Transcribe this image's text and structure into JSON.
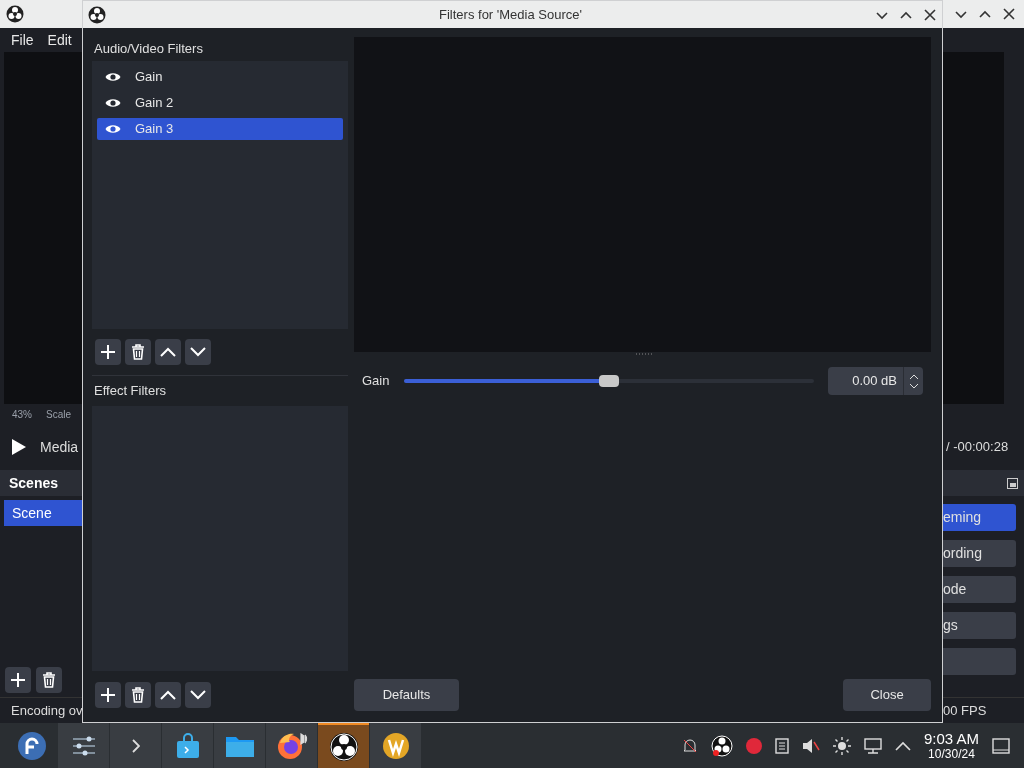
{
  "main_window": {
    "menu": [
      "File",
      "Edit"
    ],
    "zoom": "43%",
    "scale": "Scale",
    "media": "Media",
    "time": "/ -00:00:28",
    "scenes_title": "Scenes",
    "scenes": [
      {
        "label": "Scene",
        "selected": true
      }
    ],
    "controls": [
      {
        "label": "eming",
        "selected": true
      },
      {
        "label": "ording",
        "selected": false
      },
      {
        "label": "ode",
        "selected": false
      },
      {
        "label": "gs",
        "selected": false
      }
    ],
    "status_left": "Encoding ov",
    "status_right": "00 FPS"
  },
  "dialog": {
    "title": "Filters for 'Media Source'",
    "av_title": "Audio/Video Filters",
    "filters": [
      {
        "label": "Gain",
        "visible": true,
        "selected": false
      },
      {
        "label": "Gain 2",
        "visible": true,
        "selected": false
      },
      {
        "label": "Gain 3",
        "visible": true,
        "selected": true
      }
    ],
    "effect_title": "Effect Filters",
    "gain_label": "Gain",
    "gain": {
      "level": 0.5
    },
    "gain_value": "0.00 dB",
    "buttons": [
      "Defaults",
      "Close"
    ]
  },
  "taskbar": {
    "apps": [
      {
        "kind": "fedora",
        "active": false
      },
      {
        "kind": "mixer",
        "active": false
      },
      {
        "kind": "terminal",
        "active": false
      },
      {
        "kind": "store",
        "active": false
      },
      {
        "kind": "folder",
        "active": false
      },
      {
        "kind": "firefox",
        "active": false
      },
      {
        "kind": "obs",
        "active": true
      },
      {
        "kind": "wapp",
        "active": false
      }
    ],
    "time": "9:03 AM",
    "date": "10/30/24"
  }
}
